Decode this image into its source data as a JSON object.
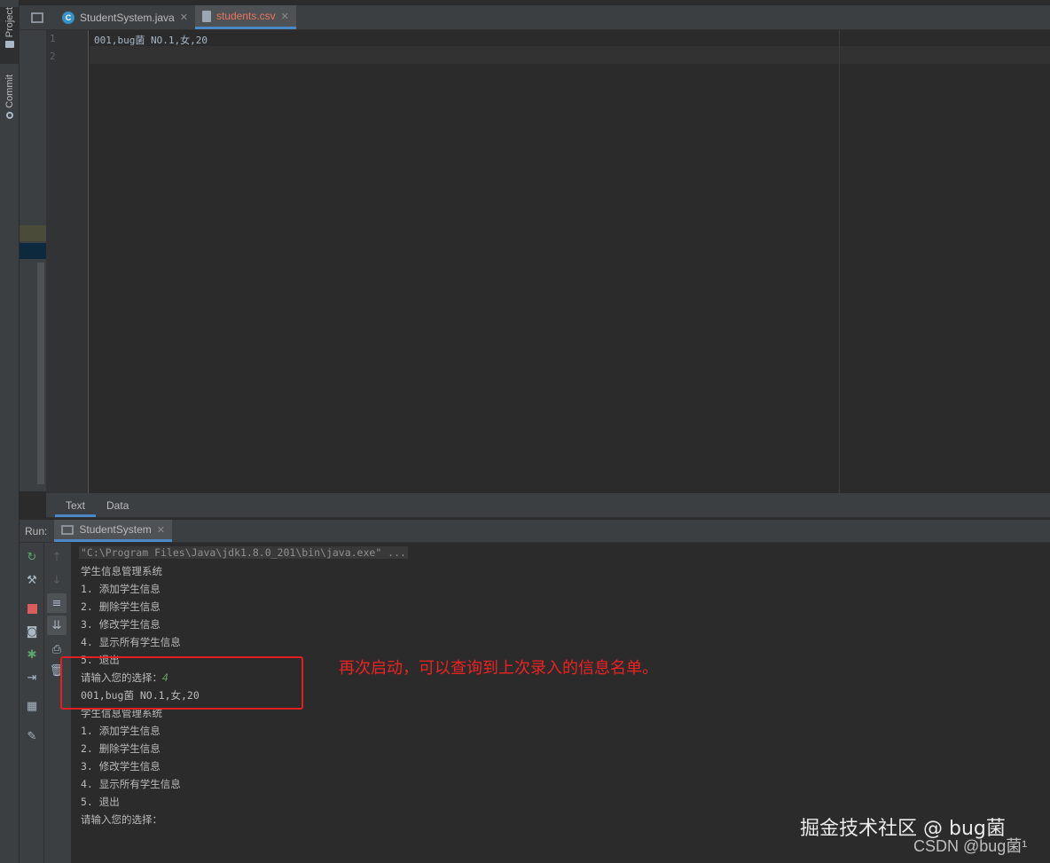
{
  "sidebar": {
    "project_label": "Project",
    "commit_label": "Commit"
  },
  "tabs": [
    {
      "label": "StudentSystem.java",
      "icon": "java-class-icon",
      "active": false
    },
    {
      "label": "students.csv",
      "icon": "csv-file-icon",
      "active": true
    }
  ],
  "editor": {
    "line_numbers": [
      "1",
      "2"
    ],
    "lines": [
      "001,bug菌 NO.1,女,20",
      ""
    ]
  },
  "bottom_tabs": [
    "Text",
    "Data"
  ],
  "run": {
    "label": "Run:",
    "config_name": "StudentSystem"
  },
  "console": {
    "command": "\"C:\\Program Files\\Java\\jdk1.8.0_201\\bin\\java.exe\" ...",
    "lines_before_input": [
      "学生信息管理系统",
      "1. 添加学生信息",
      "2. 删除学生信息",
      "3. 修改学生信息",
      "4. 显示所有学生信息",
      "5. 退出"
    ],
    "prompt": "请输入您的选择：",
    "user_input": "4",
    "result_line": "001,bug菌 NO.1,女,20",
    "lines_after": [
      "学生信息管理系统",
      "1. 添加学生信息",
      "2. 删除学生信息",
      "3. 修改学生信息",
      "4. 显示所有学生信息",
      "5. 退出",
      "请输入您的选择："
    ]
  },
  "annotation": {
    "text": "再次启动，可以查询到上次录入的信息名单。",
    "color": "#ee2222"
  },
  "watermark": {
    "line1": "掘金技术社区 @ bug菌",
    "line2": "CSDN @bug菌¹"
  },
  "colors": {
    "active_tab_text": "#e8755f",
    "user_input": "#62a05b",
    "tab_underline": "#4a88c7"
  }
}
